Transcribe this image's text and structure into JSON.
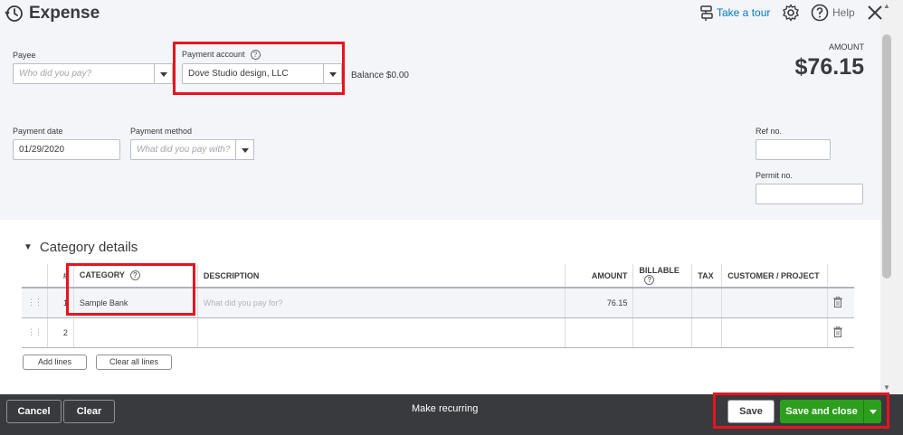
{
  "header": {
    "title": "Expense",
    "take_tour": "Take a tour",
    "help": "Help"
  },
  "form": {
    "payee_label": "Payee",
    "payee_placeholder": "Who did you pay?",
    "payment_account_label": "Payment account",
    "payment_account_value": "Dove Studio design, LLC",
    "balance_label": "Balance",
    "balance_value": "$0.00",
    "amount_label": "AMOUNT",
    "amount_value": "$76.15",
    "payment_date_label": "Payment date",
    "payment_date_value": "01/29/2020",
    "payment_method_label": "Payment method",
    "payment_method_placeholder": "What did you pay with?",
    "ref_no_label": "Ref no.",
    "permit_no_label": "Permit no."
  },
  "category_details": {
    "section_title": "Category details",
    "columns": {
      "num": "#",
      "category": "CATEGORY",
      "description": "DESCRIPTION",
      "amount": "AMOUNT",
      "billable": "BILLABLE",
      "tax": "TAX",
      "customer_project": "CUSTOMER / PROJECT"
    },
    "rows": [
      {
        "num": "1",
        "category": "Sample Bank",
        "description_placeholder": "What did you pay for?",
        "amount": "76.15"
      },
      {
        "num": "2",
        "category": "",
        "description_placeholder": "",
        "amount": ""
      }
    ],
    "add_lines": "Add lines",
    "clear_all_lines": "Clear all lines"
  },
  "footer": {
    "cancel": "Cancel",
    "clear": "Clear",
    "make_recurring": "Make recurring",
    "save": "Save",
    "save_and_close": "Save and close"
  },
  "colors": {
    "accent_blue": "#0077c5",
    "save_green": "#2ca01c",
    "highlight_red": "#e8131f",
    "footer_bg": "#393a3d"
  }
}
